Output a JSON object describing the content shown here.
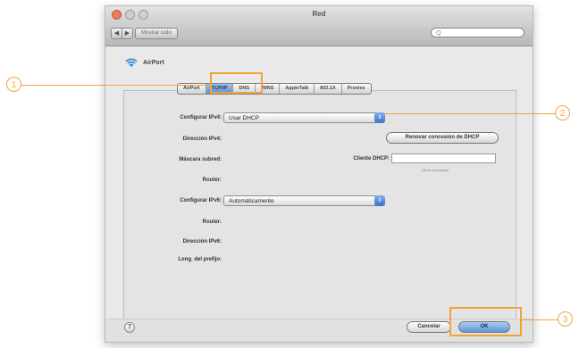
{
  "window": {
    "title": "Red"
  },
  "toolbar": {
    "back": "◀",
    "forward": "▶",
    "show_all": "Mostrar todo",
    "search_icon": "magnifier",
    "search_glyph": "Q"
  },
  "interface": {
    "name": "AirPort",
    "icon": "wifi-icon"
  },
  "tabs": [
    {
      "label": "AirPort"
    },
    {
      "label": "TCP/IP"
    },
    {
      "label": "DNS"
    },
    {
      "label": "WINS"
    },
    {
      "label": "AppleTalk"
    },
    {
      "label": "802.1X"
    },
    {
      "label": "Proxies"
    }
  ],
  "tcpip": {
    "configure_ipv4_label": "Configurar IPv4:",
    "configure_ipv4_value": "Usar DHCP",
    "ipv4_address_label": "Dirección IPv4:",
    "subnet_mask_label": "Máscara subred:",
    "router_label": "Router:",
    "renew_dhcp_button": "Renovar concesión de DHCP",
    "dhcp_client_label": "Cliente DHCP:",
    "dhcp_client_hint": "(Si es necesario)",
    "configure_ipv6_label": "Configurar IPv6:",
    "configure_ipv6_value": "Automáticamente",
    "router6_label": "Router:",
    "ipv6_address_label": "Dirección IPv6:",
    "prefix_length_label": "Long. del prefijo:"
  },
  "footer": {
    "help": "?",
    "cancel": "Cancelar",
    "ok": "OK"
  },
  "callouts": [
    "1",
    "2",
    "3"
  ],
  "colors": {
    "accent": "#f0a33d",
    "selection_blue": "#5e8fcf"
  }
}
